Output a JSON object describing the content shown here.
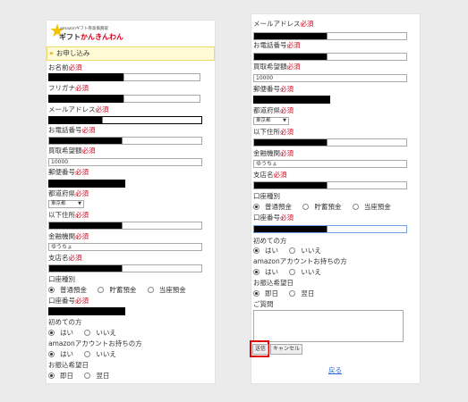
{
  "brand": {
    "small_text": "amazonギフト券高価買取",
    "name_part1": "ギフト",
    "name_part2": "かんきんわん",
    "accent": "#d0021b"
  },
  "section_title": "お申し込み",
  "required": "必須",
  "fields": {
    "name": "お名前",
    "furigana": "フリガナ",
    "email": "メールアドレス",
    "phone": "お電話番号",
    "amount": "買取希望額",
    "zip": "郵便番号",
    "prefecture": "都道府県",
    "address": "以下住所",
    "bank": "金融機関",
    "branch": "支店名",
    "account_type": "口座種別",
    "account_number": "口座番号",
    "first_time": "初めての方",
    "has_amazon": "amazonアカウントお持ちの方",
    "transfer_date": "お振込希望日",
    "questions": "ご質問"
  },
  "values": {
    "amount": "10000",
    "prefecture": "東京都",
    "bank": "ゆうちょ"
  },
  "account_type_options": [
    "普通預金",
    "貯蓄預金",
    "当座預金"
  ],
  "yes_no": [
    "はい",
    "いいえ"
  ],
  "transfer_options": [
    "即日",
    "翌日"
  ],
  "buttons": {
    "submit": "送信",
    "cancel": "キャンセル",
    "back": "戻る"
  },
  "colors": {
    "required": "#d0021b",
    "highlight": "#e00000",
    "link": "#2a6ad6",
    "section_bg": "#fffbd6"
  }
}
